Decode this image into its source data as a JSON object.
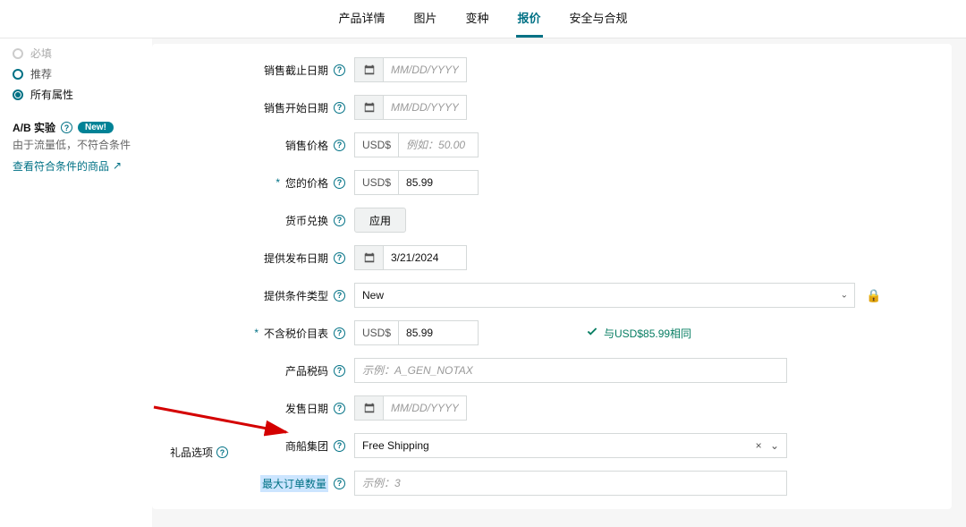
{
  "tabs": [
    "产品详情",
    "图片",
    "变种",
    "报价",
    "安全与合规"
  ],
  "active_tab_index": 3,
  "sidebar": {
    "options": [
      "必填",
      "推荐",
      "所有属性"
    ],
    "selected_index": 2,
    "ab": {
      "title": "A/B 实验",
      "pill": "New!",
      "note": "由于流量低，不符合条件",
      "link": "查看符合条件的商品"
    }
  },
  "form": {
    "sale_end": {
      "label": "销售截止日期",
      "ph": "MM/DD/YYYY"
    },
    "sale_start": {
      "label": "销售开始日期",
      "ph": "MM/DD/YYYY"
    },
    "sale_price": {
      "label": "销售价格",
      "currency": "USD$",
      "ph": "例如：50.00"
    },
    "your_price": {
      "label": "您的价格",
      "currency": "USD$",
      "value": "85.99"
    },
    "currency_ex": {
      "label": "货币兑换",
      "btn": "应用"
    },
    "release": {
      "label": "提供发布日期",
      "value": "3/21/2024"
    },
    "cond_type": {
      "label": "提供条件类型",
      "value": "New"
    },
    "notax_price": {
      "label": "不含税价目表",
      "currency": "USD$",
      "value": "85.99",
      "check": "与USD$85.99相同"
    },
    "tax_code": {
      "label": "产品税码",
      "ph": "示例：A_GEN_NOTAX"
    },
    "sale_date": {
      "label": "发售日期",
      "ph": "MM/DD/YYYY"
    },
    "ship_group": {
      "label": "商船集团",
      "value": "Free Shipping"
    },
    "max_order": {
      "label": "最大订单数量",
      "ph": "示例：3"
    }
  },
  "footer": "礼品选项"
}
